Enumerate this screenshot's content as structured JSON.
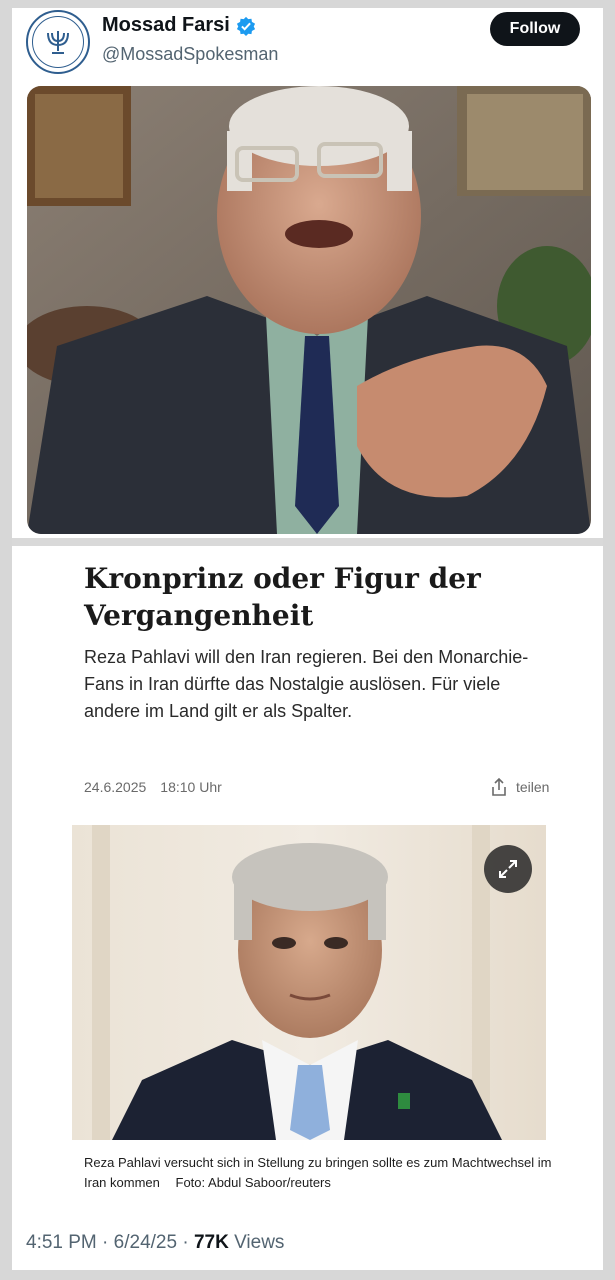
{
  "header": {
    "display_name": "Mossad Farsi",
    "handle": "@MossadSpokesman",
    "follow_label": "Follow",
    "verified_color": "#1d9bf0"
  },
  "article": {
    "headline": "Kronprinz oder Figur der Vergangenheit",
    "teaser": "Reza Pahlavi will den Iran regieren. Bei den Monarchie-Fans in Iran dürfte das Nostalgie auslösen. Für viele andere im Land gilt er als Spalter.",
    "date": "24.6.2025",
    "time": "18:10 Uhr",
    "share_label": "teilen",
    "caption": "Reza Pahlavi versucht sich in Stellung zu bringen sollte es zum Machtwechsel im Iran kommen",
    "credit": "Foto: Abdul Saboor/reuters"
  },
  "tweet_meta": {
    "time": "4:51 PM",
    "date": "6/24/25",
    "views_count": "77K",
    "views_label": "Views"
  },
  "icons": {
    "verified": "verified-badge-icon",
    "share": "share-icon",
    "expand": "expand-icon",
    "menorah": "menorah-logo-icon"
  }
}
